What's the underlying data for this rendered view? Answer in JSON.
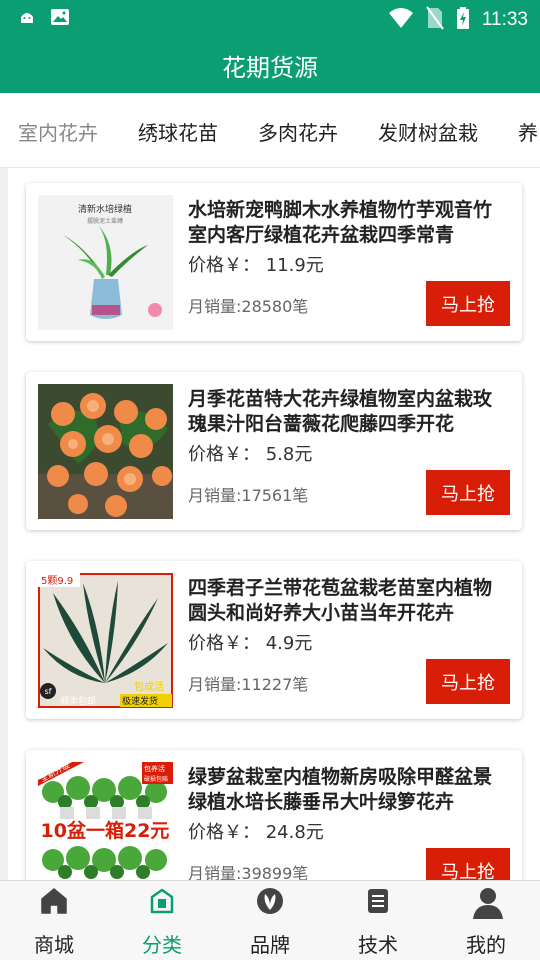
{
  "status_bar": {
    "time": "11:33"
  },
  "header": {
    "title": "花期货源"
  },
  "tabs": [
    {
      "label": "室内花卉",
      "active": true
    },
    {
      "label": "绣球花苗",
      "active": false
    },
    {
      "label": "多肉花卉",
      "active": false
    },
    {
      "label": "发财树盆栽",
      "active": false
    },
    {
      "label": "养",
      "active": false
    }
  ],
  "products": [
    {
      "title": "水培新宠鸭脚木水养植物竹芋观音竹室内客厅绿植花卉盆栽四季常青",
      "price": "价格￥：  11.9元",
      "sales": "月销量:28580笔",
      "buy_label": "马上抢",
      "image_text": "清新水培绿植",
      "image_subtext": "摆脱泥土束缚"
    },
    {
      "title": "月季花苗特大花卉绿植物室内盆栽玫瑰果汁阳台蔷薇花爬藤四季开花",
      "price": "价格￥：  5.8元",
      "sales": "月销量:17561笔",
      "buy_label": "马上抢"
    },
    {
      "title": "四季君子兰带花苞盆栽老苗室内植物圆头和尚好养大小苗当年开花卉",
      "price": "价格￥：  4.9元",
      "sales": "月销量:11227笔",
      "buy_label": "马上抢",
      "image_badge": "5颗9.9",
      "image_sf": "顺丰包邮",
      "image_tag1": "包成活",
      "image_tag2": "极速发货"
    },
    {
      "title": "绿萝盆栽室内植物新房吸除甲醛盆景绿植水培长藤垂吊大叶绿箩花卉",
      "price": "价格￥：  24.8元",
      "sales": "月销量:39899笔",
      "buy_label": "马上抢",
      "image_badge1": "全新升级",
      "image_badge2": "包养活",
      "image_badge3": "破损包赔",
      "image_promo": "10盆一箱22元"
    }
  ],
  "bottom_nav": [
    {
      "label": "商城",
      "icon": "home-icon",
      "active": false
    },
    {
      "label": "分类",
      "icon": "category-icon",
      "active": true
    },
    {
      "label": "品牌",
      "icon": "brand-icon",
      "active": false
    },
    {
      "label": "技术",
      "icon": "document-icon",
      "active": false
    },
    {
      "label": "我的",
      "icon": "profile-icon",
      "active": false
    }
  ],
  "colors": {
    "primary": "#0a9e72",
    "buy_button": "#d81e06",
    "active_tab_text": "#888888"
  }
}
